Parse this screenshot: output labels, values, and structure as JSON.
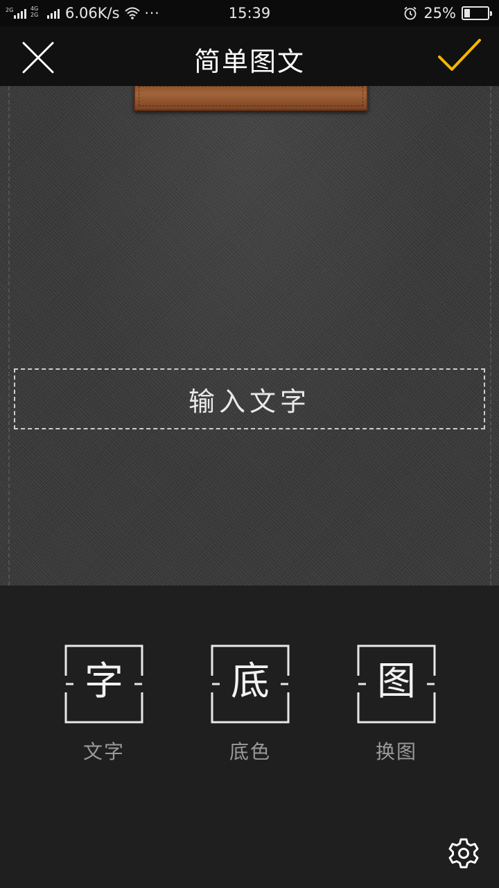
{
  "status_bar": {
    "sim1_tag": "2G",
    "sim2_tag_top": "4G",
    "sim2_tag_bottom": "2G",
    "speed": "6.06K/s",
    "more": "···",
    "time": "15:39",
    "battery_percent": "25%",
    "battery_level": 0.25,
    "icons": [
      "signal-icon",
      "wifi-icon",
      "alarm-icon",
      "battery-icon"
    ]
  },
  "header": {
    "title": "简单图文",
    "close_icon": "close-icon",
    "confirm_icon": "checkmark-icon",
    "accent_color": "#f5b800"
  },
  "canvas": {
    "text_placeholder": "输入文字",
    "background": "dark denim texture with leather tag"
  },
  "tools": [
    {
      "glyph": "字",
      "label": "文字"
    },
    {
      "glyph": "底",
      "label": "底色"
    },
    {
      "glyph": "图",
      "label": "换图"
    }
  ],
  "footer": {
    "settings_icon": "gear-icon"
  }
}
